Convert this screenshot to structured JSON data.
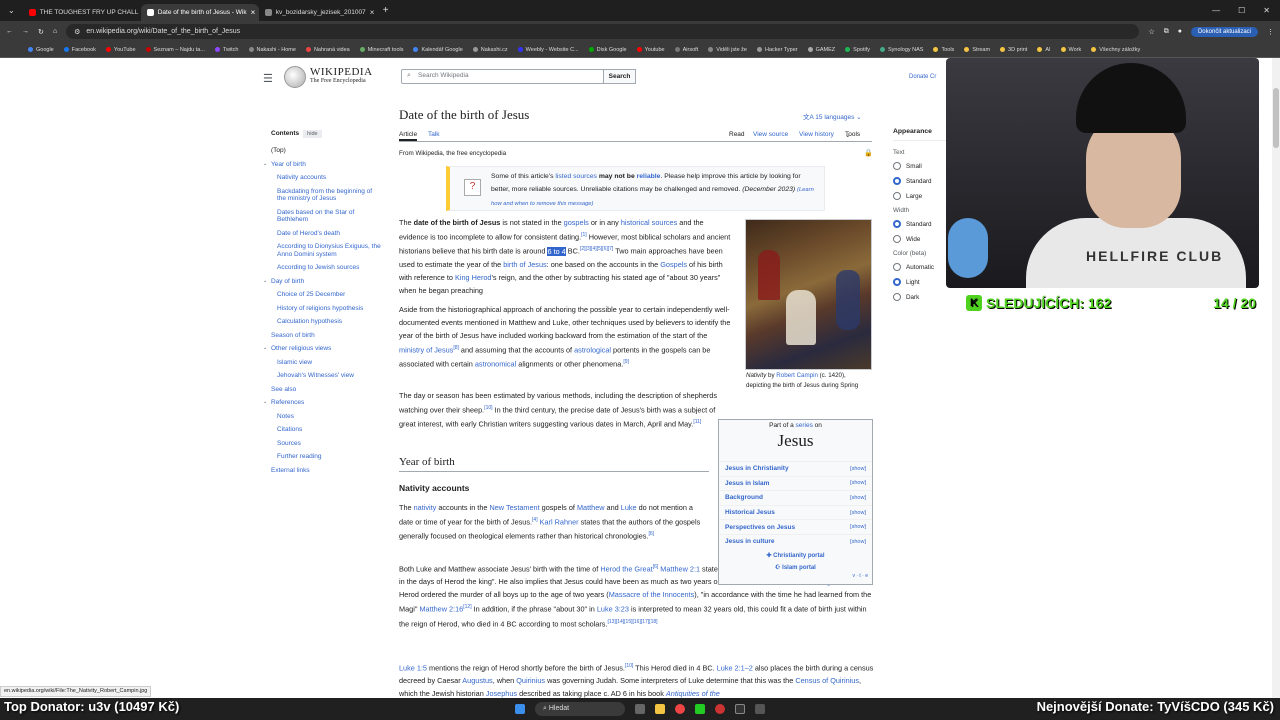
{
  "browser": {
    "tabs": [
      {
        "label": "THE TOUGHEST FRY UP CHALL",
        "color": "#ff0000"
      },
      {
        "label": "Date of the birth of Jesus - Wik",
        "color": "#ffffff"
      },
      {
        "label": "kv_bozidarsky_jezisek_201007",
        "color": "#888888"
      }
    ],
    "new_tab": "+",
    "url": "en.wikipedia.org/wiki/Date_of_the_birth_of_Jesus",
    "update_button": "Dokončit aktualizaci",
    "bookmarks": [
      "Google",
      "Facebook",
      "YouTube",
      "Seznam – Najdu ta...",
      "Twitch",
      "Nakashi - Home",
      "Nahraná videa",
      "Minecraft tools",
      "Kalendář Google",
      "Nakashi.cz",
      "Weebly - Website C...",
      "Disk Google",
      "Youtube",
      "Airsoft",
      "Viděli jste že",
      "Hacker Typer",
      "GAMEZ",
      "Spotify",
      "Synology NAS",
      "Tools",
      "Stream",
      "3D print",
      "AI",
      "Work",
      "Všechny záložky"
    ]
  },
  "wiki": {
    "logo_title": "WIKIPEDIA",
    "logo_sub": "The Free Encyclopedia",
    "search_placeholder": "Search Wikipedia",
    "search_button": "Search",
    "donate": "Donate",
    "create": "Cr",
    "title": "Date of the birth of Jesus",
    "languages": "15 languages",
    "tabs": {
      "article": "Article",
      "talk": "Talk",
      "read": "Read",
      "view_source": "View source",
      "view_history": "View history",
      "tools": "Tools"
    },
    "from": "From Wikipedia, the free encyclopedia",
    "toc": {
      "title": "Contents",
      "hide": "hide",
      "items": [
        {
          "label": "(Top)",
          "level": "top"
        },
        {
          "label": "Year of birth",
          "level": 1,
          "caret": true
        },
        {
          "label": "Nativity accounts",
          "level": 2
        },
        {
          "label": "Backdating from the beginning of the ministry of Jesus",
          "level": 2
        },
        {
          "label": "Dates based on the Star of Bethlehem",
          "level": 2
        },
        {
          "label": "Date of Herod's death",
          "level": 2
        },
        {
          "label": "According to Dionysius Exiguus, the Anno Domini system",
          "level": 2
        },
        {
          "label": "According to Jewish sources",
          "level": 2
        },
        {
          "label": "Day of birth",
          "level": 1,
          "caret": true
        },
        {
          "label": "Choice of 25 December",
          "level": 2
        },
        {
          "label": "History of religions hypothesis",
          "level": 2
        },
        {
          "label": "Calculation hypothesis",
          "level": 2
        },
        {
          "label": "Season of birth",
          "level": 1
        },
        {
          "label": "Other religious views",
          "level": 1,
          "caret": true
        },
        {
          "label": "Islamic view",
          "level": 2
        },
        {
          "label": "Jehovah's Witnesses' view",
          "level": 2
        },
        {
          "label": "See also",
          "level": 1
        },
        {
          "label": "References",
          "level": 1,
          "caret": true
        },
        {
          "label": "Notes",
          "level": 2
        },
        {
          "label": "Citations",
          "level": 2
        },
        {
          "label": "Sources",
          "level": 2
        },
        {
          "label": "Further reading",
          "level": 2
        },
        {
          "label": "External links",
          "level": 1
        }
      ]
    },
    "notice": {
      "icon": "?",
      "text_a": "Some of this article's ",
      "link_a": "listed sources",
      "text_b": " may not be ",
      "link_b": "reliable",
      "text_c": ". Please help improve this article by looking for better, more reliable sources. Unreliable citations may be challenged and removed.",
      "date": "(December 2023)",
      "learn": "(Learn how and when to remove this message)"
    },
    "para1": {
      "t1": "The ",
      "b1": "date of the birth of Jesus",
      "t2": " is not stated in the ",
      "l1": "gospels",
      "t3": " or in any ",
      "l2": "historical sources",
      "t4": " and the evidence is too incomplete to allow for consistent dating.",
      "s1": "[1]",
      "t5": " However, most biblical scholars and ancient historians believe that his birth date is around ",
      "hl": "6 to 4",
      "t6": " BC.",
      "s2": "[2][3][4][5][6][7]",
      "t7": " Two main approaches have been used to estimate the year of the ",
      "l3": "birth of Jesus",
      "t8": ": one based on the accounts in the ",
      "l4": "Gospels",
      "t9": " of his birth with reference to ",
      "l5": "King Herod",
      "t10": "'s reign, and the other by subtracting his stated age of \"about 30 years\" when he began preaching"
    },
    "para2": {
      "t1": "Aside from the historiographical approach of anchoring the possible year to certain independently well-documented events mentioned in Matthew and Luke, other techniques used by believers to identify the year of the birth of Jesus have included working backward from the estimation of the start of the ",
      "l1": "ministry of Jesus",
      "s1": "[8]",
      "t2": " and assuming that the accounts of ",
      "l2": "astrological",
      "t3": " portents in the gospels can be associated with certain ",
      "l3": "astronomical",
      "t4": " alignments or other phenomena.",
      "s2": "[9]"
    },
    "para3": {
      "t1": "The day or season has been estimated by various methods, including the description of shepherds watching over their sheep.",
      "s1": "[10]",
      "t2": " In the third century, the precise date of Jesus's birth was a subject of great interest, with early Christian writers suggesting various dates in March, April and May.",
      "s2": "[11]"
    },
    "h2": "Year of birth",
    "h3": "Nativity accounts",
    "para4": {
      "t1": "The ",
      "l1": "nativity",
      "t2": " accounts in the ",
      "l2": "New Testament",
      "t3": " gospels of ",
      "l3": "Matthew",
      "t4": " and ",
      "l4": "Luke",
      "t5": " do not mention a date or time of year for the birth of Jesus.",
      "s1": "[4]",
      "t6": " ",
      "l5": "Karl Rahner",
      "t7": " states that the authors of the gospels generally focused on theological elements rather than historical chronologies.",
      "s2": "[6]"
    },
    "para5": {
      "t1": "Both Luke and Matthew associate Jesus' birth with the time of ",
      "l1": "Herod the Great",
      "s1": "[6]",
      "t2": " ",
      "l2": "Matthew 2:1",
      "t3": " states that \"Jesus was born in Bethlehem of Judaea in the days of Herod the king\". He also implies that Jesus could have been as much as two years old at the time of the visit of the ",
      "l3": "Magi",
      "t4": ", because Herod ordered the murder of all boys up to the age of two years (",
      "l4": "Massacre of the Innocents",
      "t5": "), \"in accordance with the time he had learned from the Magi\" ",
      "l5": "Matthew 2:16",
      "s2": "[12]",
      "t6": " In addition, if the phrase \"about 30\" in ",
      "l6": "Luke 3:23",
      "t7": " is interpreted to mean 32 years old, this could fit a date of birth just within the reign of Herod, who died in 4 BC according to most scholars.",
      "s3": "[13][14][15][16][17][18]"
    },
    "para6": {
      "l1": "Luke 1:5",
      "t1": " mentions the reign of Herod shortly before the birth of Jesus.",
      "s1": "[10]",
      "t2": " This Herod died in 4 BC. ",
      "l2": "Luke 2:1–2",
      "t3": " also places the birth during a census decreed by Caesar ",
      "l3": "Augustus",
      "t4": ", when ",
      "l4": "Quirinius",
      "t5": " was governing Judah. Some interpreters of Luke determine that this was the ",
      "l5": "Census of Quirinius",
      "t6": ", which the Jewish historian ",
      "l6": "Josephus",
      "t7": " described as taking place c. AD 6 in his book ",
      "l7": "Antiquities of the"
    },
    "image_caption": {
      "i1": "Nativity",
      "t1": " by ",
      "l1": "Robert Campin",
      "t2": " (c. 1420), depicting the birth of Jesus during Spring"
    },
    "infobox": {
      "part_of": "Part of a ",
      "series": "series",
      "on": " on",
      "title": "Jesus",
      "rows": [
        {
          "label": "Jesus in Christianity",
          "action": "[show]"
        },
        {
          "label": "Jesus in Islam",
          "action": "[show]"
        },
        {
          "label": "Background",
          "action": "[show]"
        },
        {
          "label": "Historical Jesus",
          "action": "[show]"
        },
        {
          "label": "Perspectives on Jesus",
          "action": "[show]"
        },
        {
          "label": "Jesus in culture",
          "action": "[show]"
        }
      ],
      "portal1": "Christianity portal",
      "portal2": "Islam portal",
      "vte": "v · t · e"
    },
    "appearance": {
      "title": "Appearance",
      "text_label": "Text",
      "text_opts": [
        {
          "label": "Small",
          "on": false
        },
        {
          "label": "Standard",
          "on": true
        },
        {
          "label": "Large",
          "on": false
        }
      ],
      "width_label": "Width",
      "width_opts": [
        {
          "label": "Standard",
          "on": true
        },
        {
          "label": "Wide",
          "on": false
        }
      ],
      "color_label": "Color (beta)",
      "color_opts": [
        {
          "label": "Automatic",
          "on": false
        },
        {
          "label": "Light",
          "on": true
        },
        {
          "label": "Dark",
          "on": false
        }
      ]
    },
    "status_url": "en.wikipedia.org/wiki/File:The_Nativity_Robert_Campin.jpg"
  },
  "stream": {
    "followers_label": "SLEDUJÍCÍCH: 162",
    "goal": "14 / 20",
    "shirt_text": "HELLFIRE CLUB",
    "top_donator": "Top Donator: u3v (10497 Kč)",
    "latest_donate": "Nejnovější Donate: TyVíšCDO (345 Kč)"
  },
  "taskbar": {
    "search": "Hledat"
  }
}
